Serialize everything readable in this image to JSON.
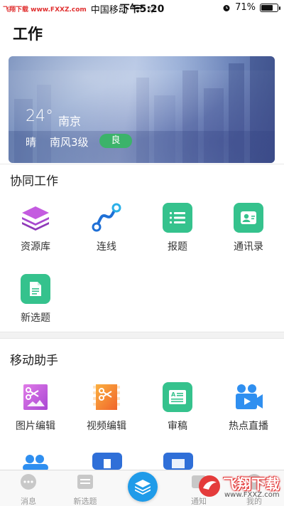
{
  "status_bar": {
    "watermark": "飞翔下载 www.FXXZ.com",
    "carrier": "中国移动",
    "time": "下午5:20",
    "battery": "71%",
    "battery_level": 0.71
  },
  "page": {
    "title": "工作"
  },
  "weather": {
    "temperature": "24°",
    "city": "南京",
    "condition": "晴",
    "wind": "南风3级",
    "air_quality": "良"
  },
  "sections": {
    "collab": {
      "title": "协同工作",
      "items": [
        {
          "label": "资源库",
          "icon": "layers-icon"
        },
        {
          "label": "连线",
          "icon": "connection-icon"
        },
        {
          "label": "报题",
          "icon": "list-icon"
        },
        {
          "label": "通讯录",
          "icon": "contact-card-icon"
        },
        {
          "label": "新选题",
          "icon": "new-document-icon"
        }
      ]
    },
    "assistant": {
      "title": "移动助手",
      "items": [
        {
          "label": "图片编辑",
          "icon": "image-edit-icon"
        },
        {
          "label": "视频编辑",
          "icon": "video-edit-icon"
        },
        {
          "label": "审稿",
          "icon": "review-icon"
        },
        {
          "label": "热点直播",
          "icon": "live-camera-icon"
        }
      ]
    }
  },
  "tab_bar": {
    "items": [
      {
        "label": "消息",
        "icon": "message-icon"
      },
      {
        "label": "新选题",
        "icon": "new-topic-icon"
      },
      {
        "label": "",
        "icon": "layers-icon"
      },
      {
        "label": "通知",
        "icon": "notice-icon"
      },
      {
        "label": "我的",
        "icon": "profile-icon"
      }
    ]
  },
  "watermark_logo": {
    "text": "飞翔下载",
    "url": "www.FXXZ.com"
  },
  "colors": {
    "accent": "#1f9be9",
    "green_tile": "#35c28d",
    "aqi_green": "#3bb36a",
    "purple": "#b04fd6",
    "orange": "#f28a24"
  }
}
